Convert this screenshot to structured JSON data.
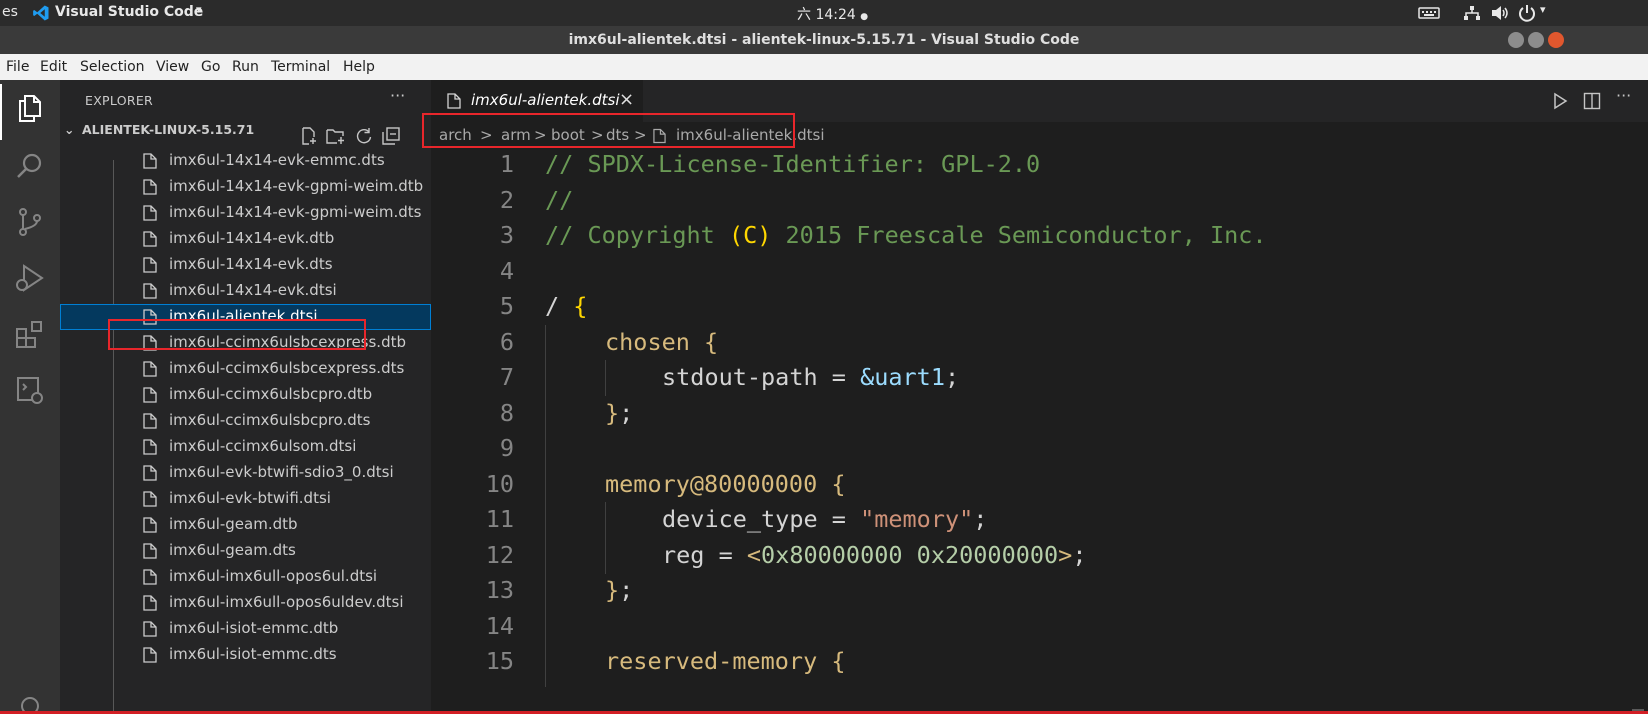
{
  "system_bar": {
    "activities": "es",
    "app_name": "Visual Studio Code",
    "clock": "六 14:24"
  },
  "window": {
    "title": "imx6ul-alientek.dtsi - alientek-linux-5.15.71 - Visual Studio Code"
  },
  "menu": [
    "File",
    "Edit",
    "Selection",
    "View",
    "Go",
    "Run",
    "Terminal",
    "Help"
  ],
  "explorer": {
    "title": "EXPLORER",
    "more": "···",
    "root": "ALIENTEK-LINUX-5.15.71",
    "files": [
      "imx6ul-14x14-evk-emmc.dts",
      "imx6ul-14x14-evk-gpmi-weim.dtb",
      "imx6ul-14x14-evk-gpmi-weim.dts",
      "imx6ul-14x14-evk.dtb",
      "imx6ul-14x14-evk.dts",
      "imx6ul-14x14-evk.dtsi",
      "imx6ul-alientek.dtsi",
      "imx6ul-ccimx6ulsbcexpress.dtb",
      "imx6ul-ccimx6ulsbcexpress.dts",
      "imx6ul-ccimx6ulsbcpro.dtb",
      "imx6ul-ccimx6ulsbcpro.dts",
      "imx6ul-ccimx6ulsom.dtsi",
      "imx6ul-evk-btwifi-sdio3_0.dtsi",
      "imx6ul-evk-btwifi.dtsi",
      "imx6ul-geam.dtb",
      "imx6ul-geam.dts",
      "imx6ul-imx6ull-opos6ul.dtsi",
      "imx6ul-imx6ull-opos6uldev.dtsi",
      "imx6ul-isiot-emmc.dtb",
      "imx6ul-isiot-emmc.dts"
    ],
    "selected": "imx6ul-alientek.dtsi"
  },
  "editor": {
    "tab_label": "imx6ul-alientek.dtsi",
    "tab_close": "×",
    "breadcrumbs": [
      "arch",
      "arm",
      "boot",
      "dts",
      "imx6ul-alientek.dtsi"
    ],
    "breadcrumb_sep": ">",
    "line_numbers": [
      "1",
      "2",
      "3",
      "4",
      "5",
      "6",
      "7",
      "8",
      "9",
      "10",
      "11",
      "12",
      "13",
      "14",
      "15"
    ],
    "code": {
      "l1": "// SPDX-License-Identifier: GPL-2.0",
      "l2": "//",
      "l3a": "// Copyright ",
      "l3b": "(C)",
      "l3c": " 2015 Freescale Semiconductor, Inc.",
      "l5a": "/ ",
      "l5b": "{",
      "l6a": "chosen ",
      "l6b": "{",
      "l7a": "stdout-path = ",
      "l7b": "&uart1",
      "l7c": ";",
      "l8a": "}",
      "l8b": ";",
      "l10a": "memory@80000000 ",
      "l10b": "{",
      "l11a": "device_type = ",
      "l11b": "\"memory\"",
      "l11c": ";",
      "l12a": "reg = ",
      "l12b": "<",
      "l12c": "0x80000000 0x20000000",
      "l12d": ">",
      "l12e": ";",
      "l13a": "}",
      "l13b": ";",
      "l15a": "reserved-memory ",
      "l15b": "{"
    }
  },
  "colors": {
    "annotation_box": "#e8262b",
    "selection": "#04395e",
    "comment": "#6a9955"
  }
}
